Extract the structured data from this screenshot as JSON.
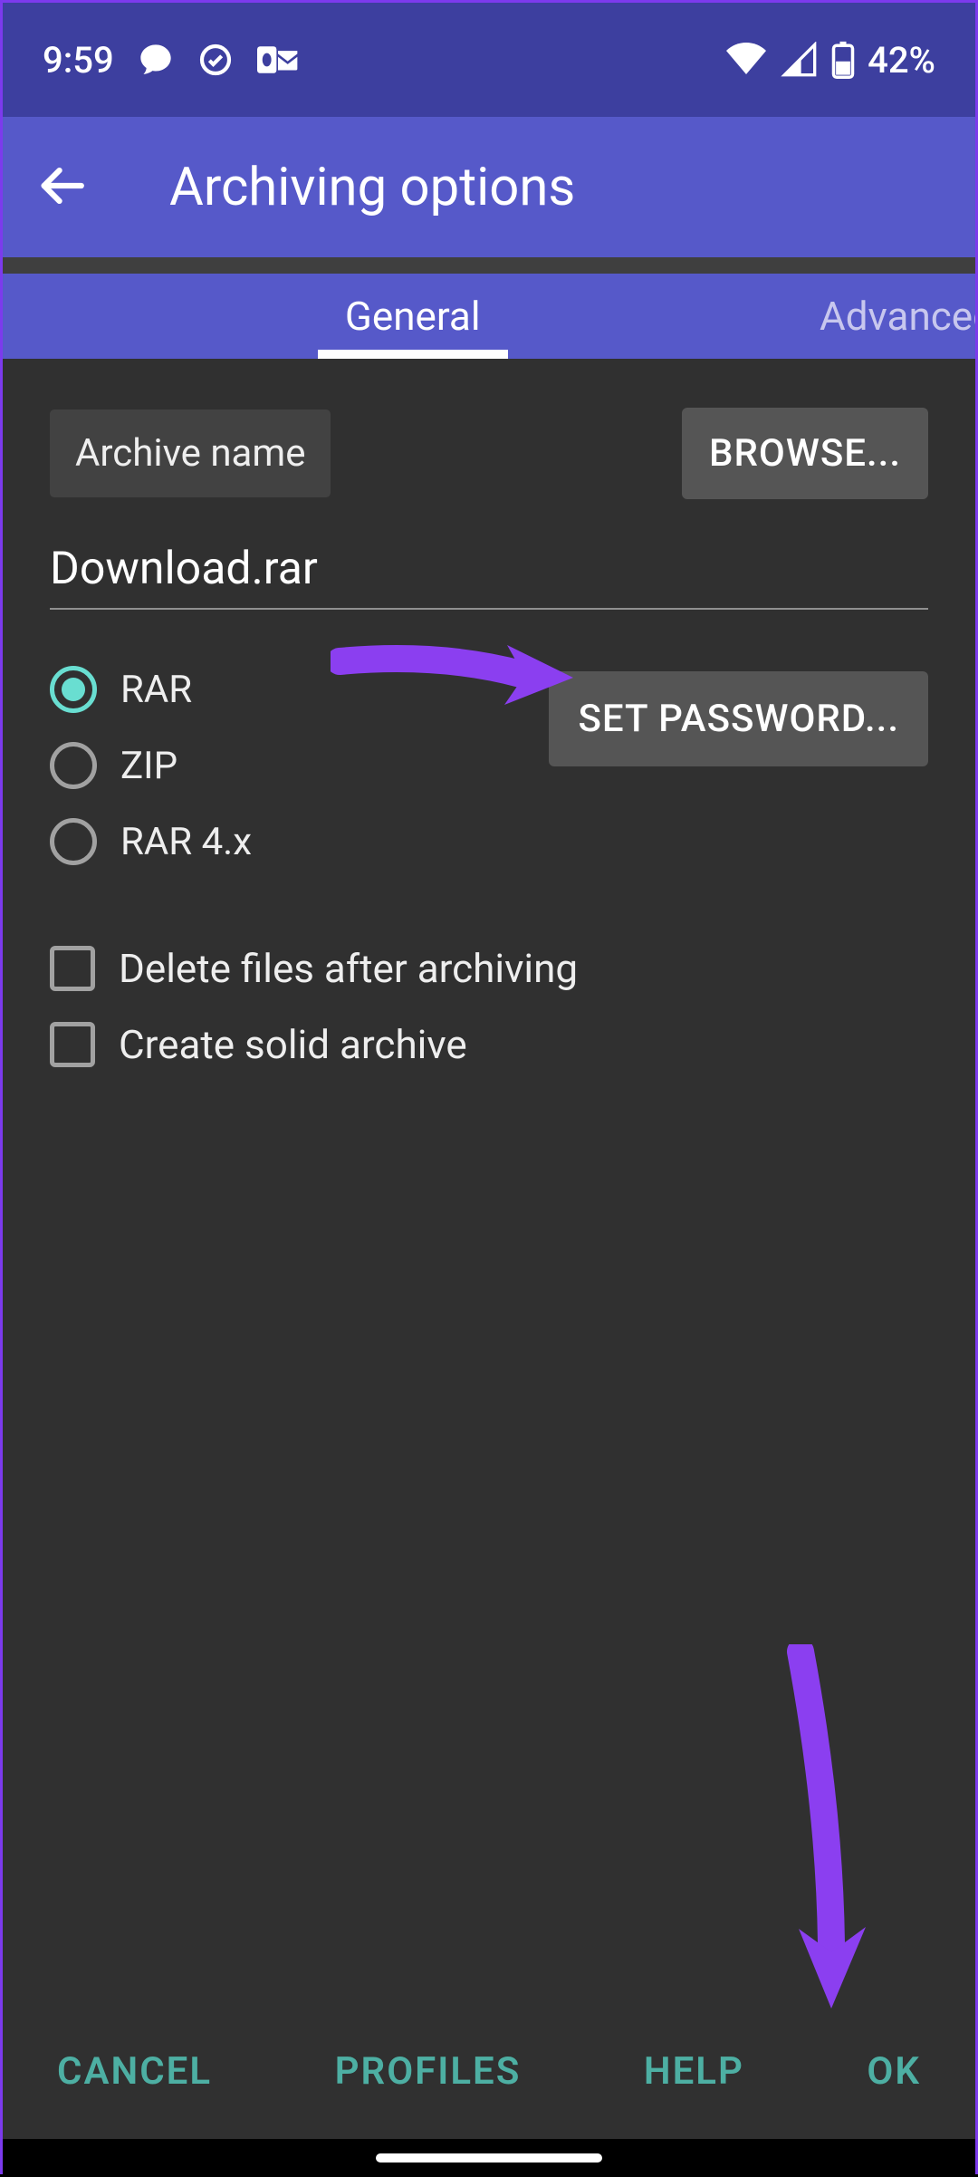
{
  "status": {
    "time": "9:59",
    "battery": "42%"
  },
  "appBar": {
    "title": "Archiving options"
  },
  "tabs": {
    "general": "General",
    "advanced": "Advanced"
  },
  "archiveName": {
    "label": "Archive name",
    "browse": "BROWSE...",
    "value": "Download.rar"
  },
  "format": {
    "options": [
      "RAR",
      "ZIP",
      "RAR 4.x"
    ],
    "selected": "RAR"
  },
  "setPassword": "SET PASSWORD...",
  "options": {
    "deleteAfter": "Delete files after archiving",
    "solid": "Create solid archive"
  },
  "bottom": {
    "cancel": "CANCEL",
    "profiles": "PROFILES",
    "help": "HELP",
    "ok": "OK"
  }
}
